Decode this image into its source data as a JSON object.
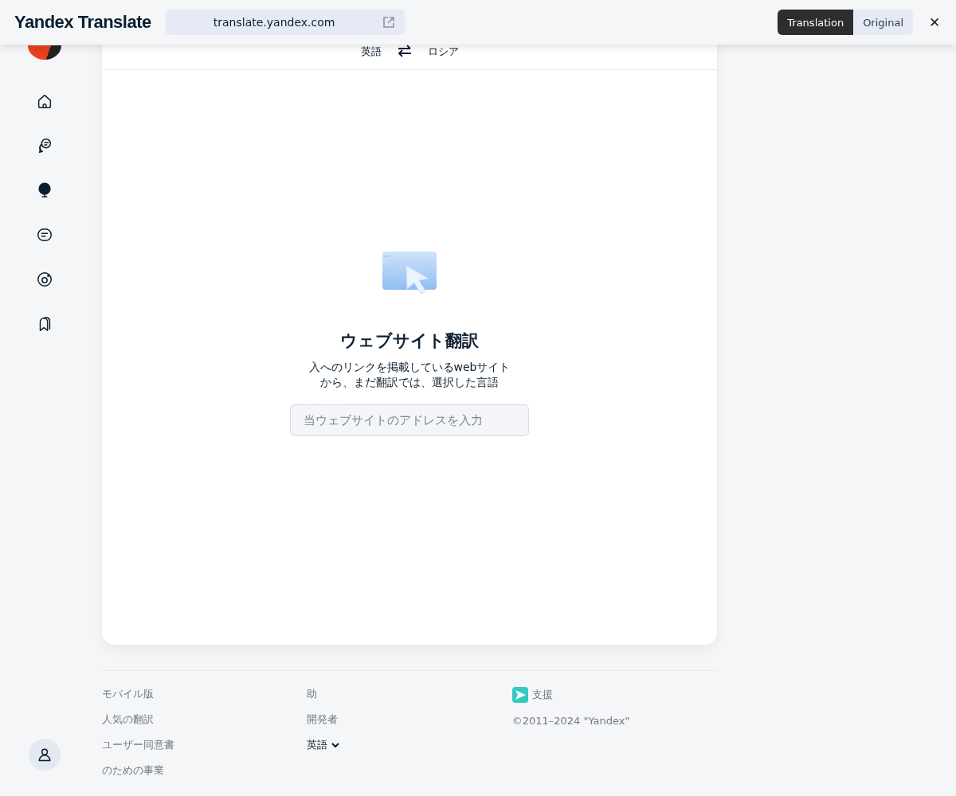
{
  "topbar": {
    "logo": "Yandex Translate",
    "url": "translate.yandex.com",
    "toggle": [
      {
        "label": "Translation",
        "selected": true
      },
      {
        "label": "Original",
        "selected": false
      }
    ],
    "close": "✕"
  },
  "sidebar": {
    "items": [
      {
        "kind": "home"
      },
      {
        "kind": "chat"
      },
      {
        "kind": "tree"
      },
      {
        "kind": "message"
      },
      {
        "kind": "camera"
      },
      {
        "kind": "bookmark"
      }
    ]
  },
  "languages": {
    "source": "英語",
    "target": "ロシア"
  },
  "website": {
    "title": "ウェブサイト翻訳",
    "description": [
      "入へのリンクを掲載しているwebサイト",
      "から、まだ翻訳では、選択した言語"
    ],
    "placeholder": "当ウェブサイトのアドレスを入力"
  },
  "footer": {
    "columns": [
      {
        "links": [
          "モバイル版",
          "人気の翻訳",
          "ユーザー同意書",
          "のための事業"
        ]
      },
      {
        "links": [
          "助",
          "開発者"
        ],
        "language": "英語"
      },
      {
        "support": "支援",
        "copyright": "©2011–2024 \"Yandex\""
      }
    ]
  }
}
